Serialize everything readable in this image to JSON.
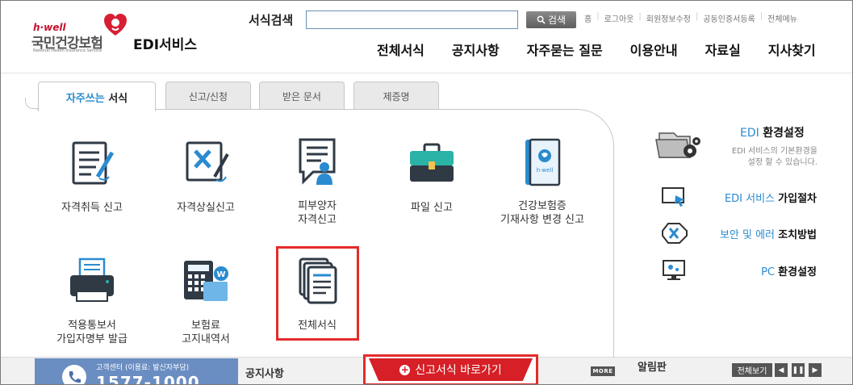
{
  "header": {
    "logo": {
      "brand": "h·well",
      "korean_name": "국민건강보험",
      "english_name": "National Health Insurance Service"
    },
    "service_title": "EDI서비스",
    "search": {
      "label": "서식검색",
      "value": "",
      "placeholder": "",
      "button_label": "검색"
    },
    "util_links": [
      "홈",
      "로그아웃",
      "회원정보수정",
      "공동인증서등록",
      "전체메뉴"
    ],
    "nav": [
      "전체서식",
      "공지사항",
      "자주묻는 질문",
      "이용안내",
      "자료실",
      "지사찾기"
    ]
  },
  "tabs": [
    {
      "label_highlight": "자주쓰는",
      "label_rest": "서식",
      "active": true
    },
    {
      "label": "신고/신청",
      "active": false
    },
    {
      "label": "받은 문서",
      "active": false
    },
    {
      "label": "제증명",
      "active": false
    }
  ],
  "forms": [
    {
      "lines": [
        "자격취득 신고"
      ],
      "icon": "document-pen-icon"
    },
    {
      "lines": [
        "자격상실신고"
      ],
      "icon": "document-cancel-icon"
    },
    {
      "lines": [
        "피부양자",
        "자격신고"
      ],
      "icon": "dependent-person-icon"
    },
    {
      "lines": [
        "파일 신고"
      ],
      "icon": "briefcase-icon"
    },
    {
      "lines": [
        "건강보험증",
        "기재사항 변경 신고"
      ],
      "icon": "insurance-card-icon"
    },
    {
      "lines": [
        "적용통보서",
        "가입자명부 발급"
      ],
      "icon": "printer-icon"
    },
    {
      "lines": [
        "보험료",
        "고지내역서"
      ],
      "icon": "calculator-word-icon"
    },
    {
      "lines": [
        "전체서식"
      ],
      "icon": "document-stack-icon"
    }
  ],
  "right": {
    "env": {
      "title_blue": "EDI",
      "title_dark": "환경설정",
      "desc_lines": [
        "EDI 서비스의 기본환경을",
        "설정 할 수 있습니다."
      ]
    },
    "links": [
      {
        "blue": "EDI 서비스",
        "dark": "가입절차",
        "icon": "monitor-cursor-icon"
      },
      {
        "blue": "보안 및 에러",
        "dark": "조치방법",
        "icon": "error-x-icon"
      },
      {
        "blue": "PC",
        "dark": "환경설정",
        "icon": "pc-settings-icon"
      }
    ]
  },
  "bottom": {
    "call_center": {
      "label": "고객센터 (이용료: 발신자부담)",
      "number": "1577-1000"
    },
    "notice": "공지사항",
    "shortcut": "신고서식 바로가기",
    "more": "MORE",
    "board": "알림판",
    "view_all": "전체보기"
  },
  "colors": {
    "accent_blue": "#2a8bd0",
    "brand_red": "#c8102e",
    "highlight_red": "#e42b2b",
    "shortcut_red": "#d61f26"
  }
}
